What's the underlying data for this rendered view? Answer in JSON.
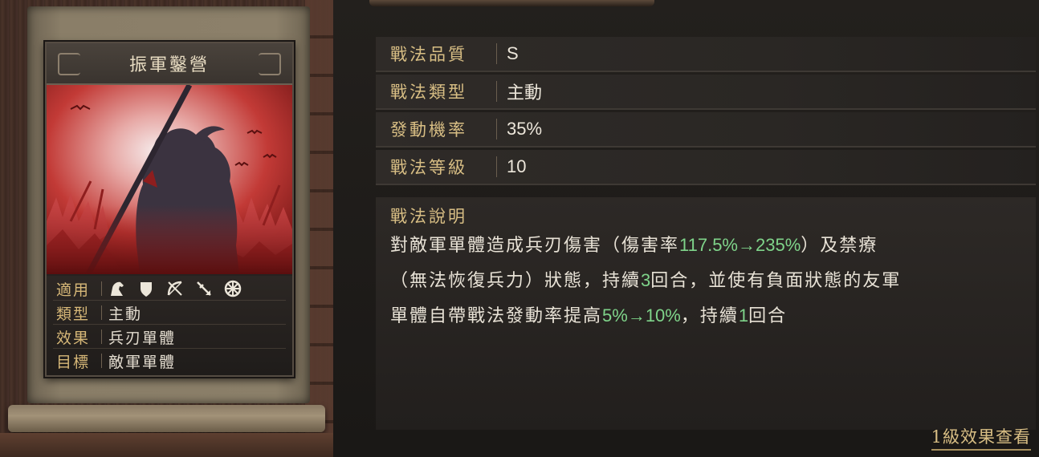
{
  "skill": {
    "name": "振軍鑿營",
    "attributes": {
      "applicable_label": "適用",
      "type_label": "類型",
      "type_value": "主動",
      "effect_label": "效果",
      "effect_value": "兵刃單體",
      "target_label": "目標",
      "target_value": "敵軍單體",
      "unit_icons": [
        "cavalry-icon",
        "shield-icon",
        "bow-icon",
        "spear-icon",
        "wheel-icon"
      ]
    }
  },
  "info": [
    {
      "label": "戰法品質",
      "value": "S"
    },
    {
      "label": "戰法類型",
      "value": "主動"
    },
    {
      "label": "發動機率",
      "value": "35%"
    },
    {
      "label": "戰法等級",
      "value": "10"
    }
  ],
  "description": {
    "title": "戰法說明",
    "segments": {
      "p1": "對敵軍單體造成兵刃傷害（傷害率",
      "h1": "117.5%→235%",
      "p2": "）及禁療",
      "p3": "（無法恢復兵力）狀態，持續",
      "h2": "3",
      "p4": "回合，並使有負面狀態的友軍",
      "p5": "單體自帶戰法發動率提高",
      "h3": "5%→10%",
      "p6": "，持續",
      "h4": "1",
      "p7": "回合"
    }
  },
  "footer_link": "1級效果查看",
  "colors": {
    "label_gold": "#d8be84",
    "highlight_green": "#7fd48a",
    "art_red": "#b32a2a"
  }
}
